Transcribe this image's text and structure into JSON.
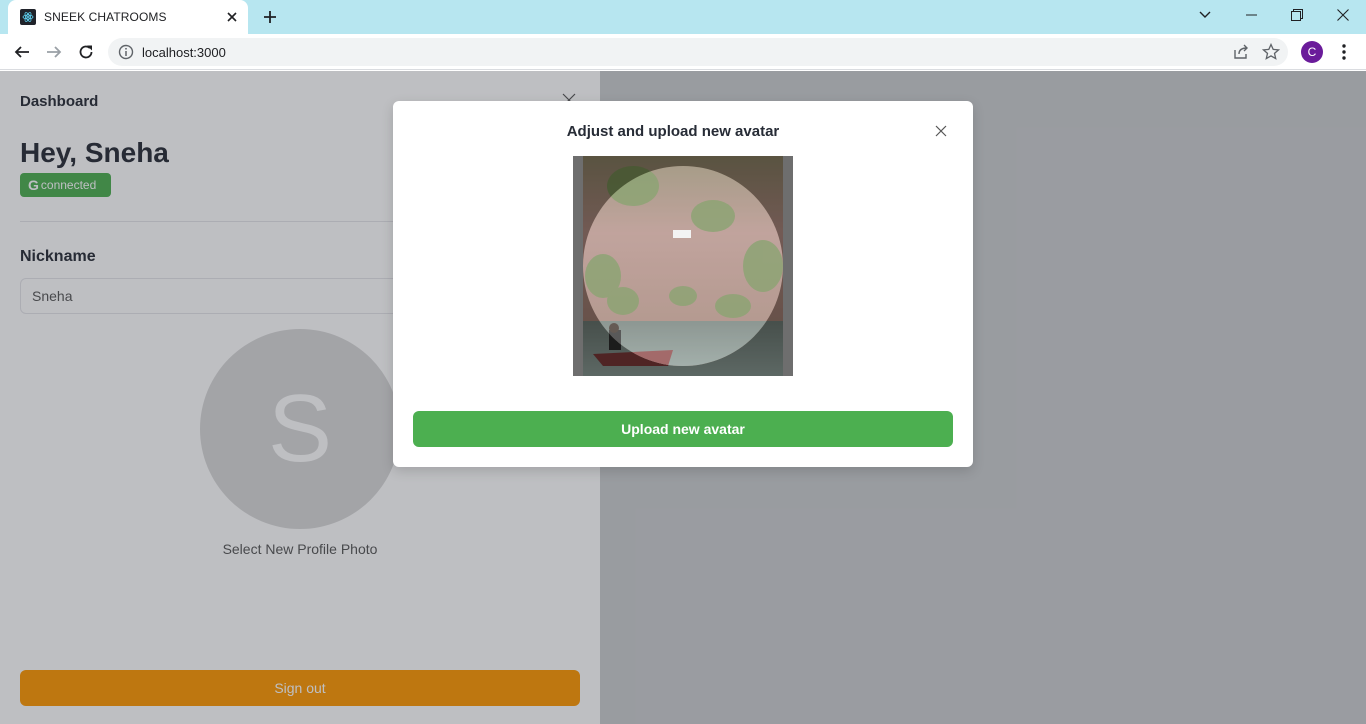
{
  "browser": {
    "tab_title": "SNEEK CHATROOMS",
    "url": "localhost:3000",
    "profile_initial": "C",
    "colors": {
      "tabstrip": "#b7e6f0",
      "profile": "#6a1b9a"
    }
  },
  "drawer": {
    "title": "Dashboard",
    "greeting": "Hey, Sneha",
    "provider_badge": {
      "icon": "G",
      "label": "connected"
    },
    "nickname_label": "Nickname",
    "nickname_value": "Sneha",
    "avatar_initial": "S",
    "select_photo_label": "Select New Profile Photo",
    "signout_label": "Sign out",
    "colors": {
      "signout": "#ff9800",
      "badge": "#4caf50"
    }
  },
  "modal": {
    "title": "Adjust and upload new avatar",
    "upload_label": "Upload new avatar",
    "colors": {
      "upload": "#4caf50"
    }
  }
}
